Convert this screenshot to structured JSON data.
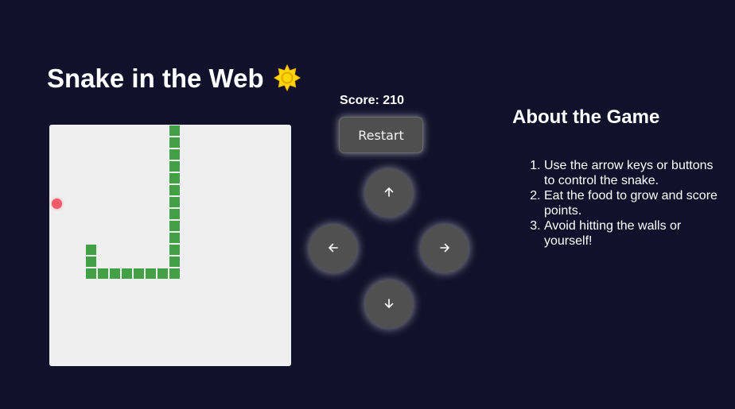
{
  "app": {
    "title": "Snake in the Web",
    "theme_icon": "sun-icon"
  },
  "game": {
    "score_text": "Score: 210",
    "restart_label": "Restart",
    "board_color": "#efefef",
    "snake_color": "#43a047",
    "food_color": "#f25c6a",
    "grid": {
      "cols": 20,
      "rows": 20
    },
    "snake": [
      [
        10,
        0
      ],
      [
        10,
        1
      ],
      [
        10,
        2
      ],
      [
        10,
        3
      ],
      [
        10,
        4
      ],
      [
        10,
        5
      ],
      [
        10,
        6
      ],
      [
        10,
        7
      ],
      [
        10,
        8
      ],
      [
        10,
        9
      ],
      [
        10,
        10
      ],
      [
        10,
        11
      ],
      [
        10,
        12
      ],
      [
        9,
        12
      ],
      [
        8,
        12
      ],
      [
        7,
        12
      ],
      [
        6,
        12
      ],
      [
        5,
        12
      ],
      [
        4,
        12
      ],
      [
        3,
        12
      ],
      [
        3,
        11
      ],
      [
        3,
        10
      ]
    ],
    "food": [
      0,
      6
    ]
  },
  "controls": {
    "up_icon": "arrow-up-icon",
    "left_icon": "arrow-left-icon",
    "right_icon": "arrow-right-icon",
    "down_icon": "arrow-down-icon"
  },
  "about": {
    "heading": "About the Game",
    "rules": [
      "Use the arrow keys or buttons to control the snake.",
      "Eat the food to grow and score points.",
      "Avoid hitting the walls or yourself!"
    ]
  }
}
